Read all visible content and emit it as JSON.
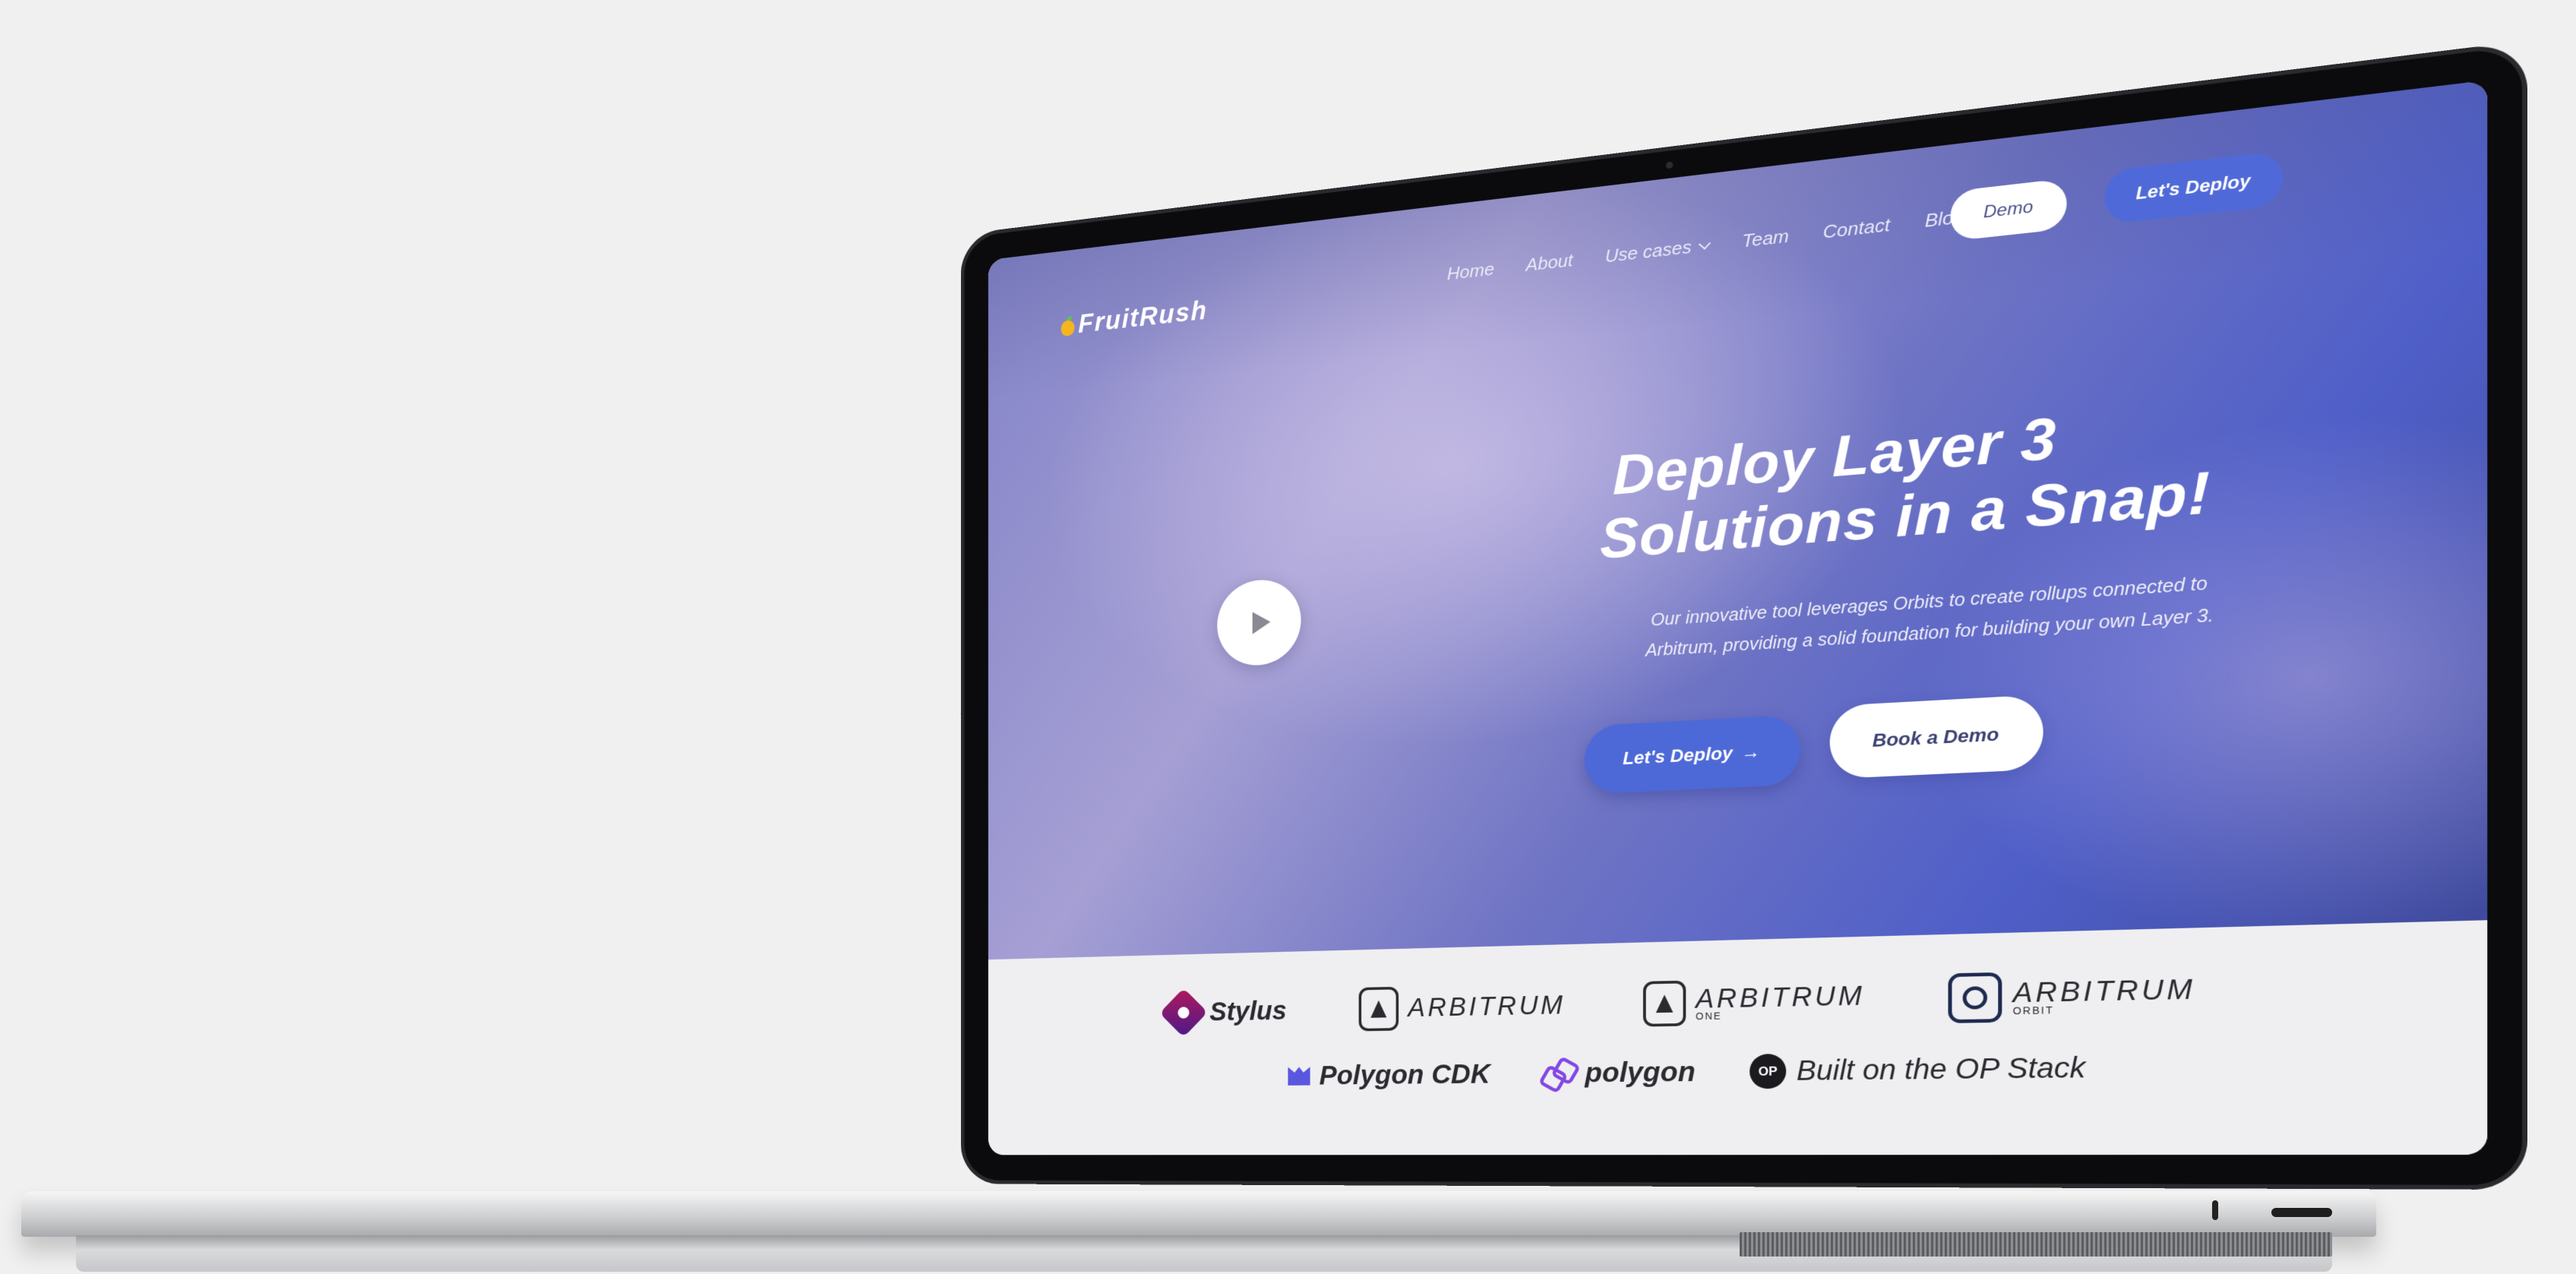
{
  "site": {
    "logo_text": "FruitRush"
  },
  "nav": {
    "links": [
      "Home",
      "About",
      "Use cases",
      "Team",
      "Contact",
      "Blog"
    ],
    "demo_label": "Demo",
    "deploy_label": "Let's Deploy"
  },
  "hero": {
    "title_line1": "Deploy Layer 3",
    "title_line2": "Solutions in a Snap!",
    "subtitle_line1": "Our innovative tool leverages Orbits to create rollups connected to",
    "subtitle_line2": "Arbitrum, providing a solid foundation for building your own Layer 3.",
    "primary_button": "Let's Deploy",
    "primary_button_arrow": "→",
    "secondary_button": "Book a Demo"
  },
  "partners": {
    "stylus": "Stylus",
    "arbitrum": "ARBITRUM",
    "arbitrum_one": "ARBITRUM",
    "arbitrum_one_sub": "ONE",
    "arbitrum_orbit": "ARBITRUM",
    "arbitrum_orbit_sub": "ORBIT",
    "polygon_cdk": "Polygon CDK",
    "polygon": "polygon",
    "op_badge": "OP",
    "op_stack": "Built on the OP Stack"
  },
  "colors": {
    "accent_blue": "#4f6ad8",
    "logo_fruit": "#f5b51f",
    "polygon_purple": "#8247e5"
  }
}
